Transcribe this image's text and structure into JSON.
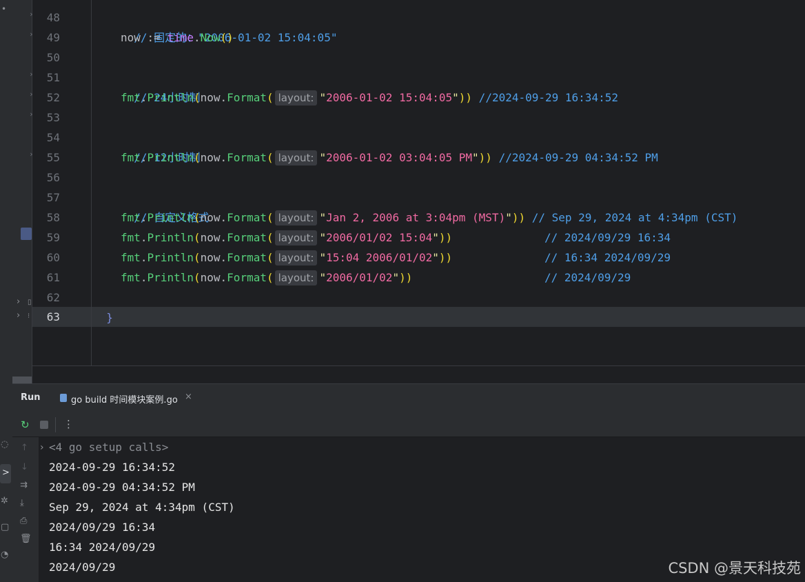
{
  "editor": {
    "lines": [
      {
        "num": "48"
      },
      {
        "num": "49"
      },
      {
        "num": "50"
      },
      {
        "num": "51"
      },
      {
        "num": "52"
      },
      {
        "num": "53"
      },
      {
        "num": "54"
      },
      {
        "num": "55"
      },
      {
        "num": "56"
      },
      {
        "num": "57"
      },
      {
        "num": "58"
      },
      {
        "num": "59"
      },
      {
        "num": "60"
      },
      {
        "num": "61"
      },
      {
        "num": "62"
      },
      {
        "num": "63"
      }
    ],
    "current_line": "63",
    "code": {
      "l48_comment": "// 固定的：\"2006-01-02 15:04:05\"",
      "l49_var": "now",
      "l49_assign": " := ",
      "l49_pkg": "time",
      "l49_dot": ".",
      "l49_fn": "Now",
      "l49_parens": "()",
      "l51_comment": "// 24小时制",
      "l54_comment": "// 12小时制",
      "l57_comment": "// 自定义格式",
      "l62_brace": "}",
      "fmt": "fmt",
      "println": "Println",
      "now": "now",
      "format": "Format",
      "hint": "layout:",
      "l52_str": "2006-01-02 15:04:05",
      "l52_comment": " //2024-09-29 16:34:52",
      "l55_str": "2006-01-02 03:04:05 PM",
      "l55_comment": " //2024-09-29 04:34:52 PM",
      "l58_str": "Jan 2, 2006 at 3:04pm (MST)",
      "l58_comment": " // Sep 29, 2024 at 4:34pm (CST)",
      "l59_str": "2006/01/02 15:04",
      "l59_comment": "// 2024/09/29 16:34",
      "l60_str": "15:04 2006/01/02",
      "l60_comment": "// 16:34 2024/09/29",
      "l61_str": "2006/01/02",
      "l61_comment": "// 2024/09/29"
    }
  },
  "run_panel": {
    "title": "Run",
    "tab_label": "go build 时间模块案例.go",
    "tab_close": "×",
    "setup_calls": "<4 go setup calls>",
    "output": [
      "2024-09-29 16:34:52",
      "2024-09-29 04:34:52 PM",
      "Sep 29, 2024 at 4:34pm (CST)",
      "2024/09/29 16:34",
      "16:34 2024/09/29",
      "2024/09/29"
    ]
  },
  "watermark": "CSDN @景天科技苑",
  "colors": {
    "comment": "#4f9fe8",
    "function": "#57d07a",
    "string": "#f06aa2",
    "accent": "#3574f0"
  }
}
